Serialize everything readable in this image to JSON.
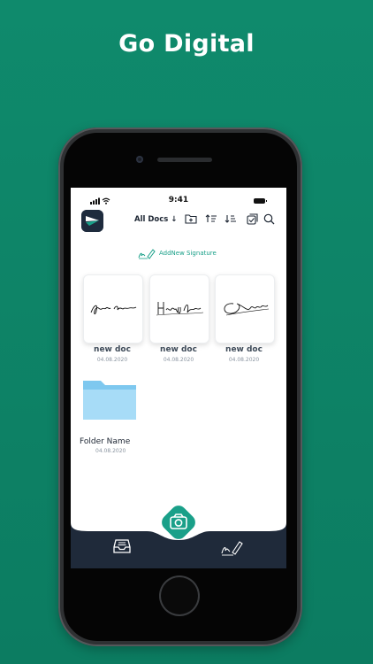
{
  "headline": "Go Digital",
  "status": {
    "time": "9:41"
  },
  "toolbar": {
    "filter_label": "All Docs ↓"
  },
  "add_signature": {
    "label": "AddNew Signature"
  },
  "documents": [
    {
      "name": "new doc",
      "date": "04.08.2020"
    },
    {
      "name": "new doc",
      "date": "04.08.2020"
    },
    {
      "name": "new doc",
      "date": "04.08.2020"
    }
  ],
  "folder": {
    "name": "Folder Name",
    "date": "04.08.2020"
  },
  "colors": {
    "background": "#0f8a6c",
    "accent": "#1aa089",
    "tabbar": "#1f2a3a"
  },
  "icons": [
    "app-logo-icon",
    "folder-add-icon",
    "sort-asc-icon",
    "sort-desc-icon",
    "select-icon",
    "search-icon",
    "signature-icon",
    "camera-icon",
    "inbox-icon",
    "pen-sign-icon"
  ]
}
